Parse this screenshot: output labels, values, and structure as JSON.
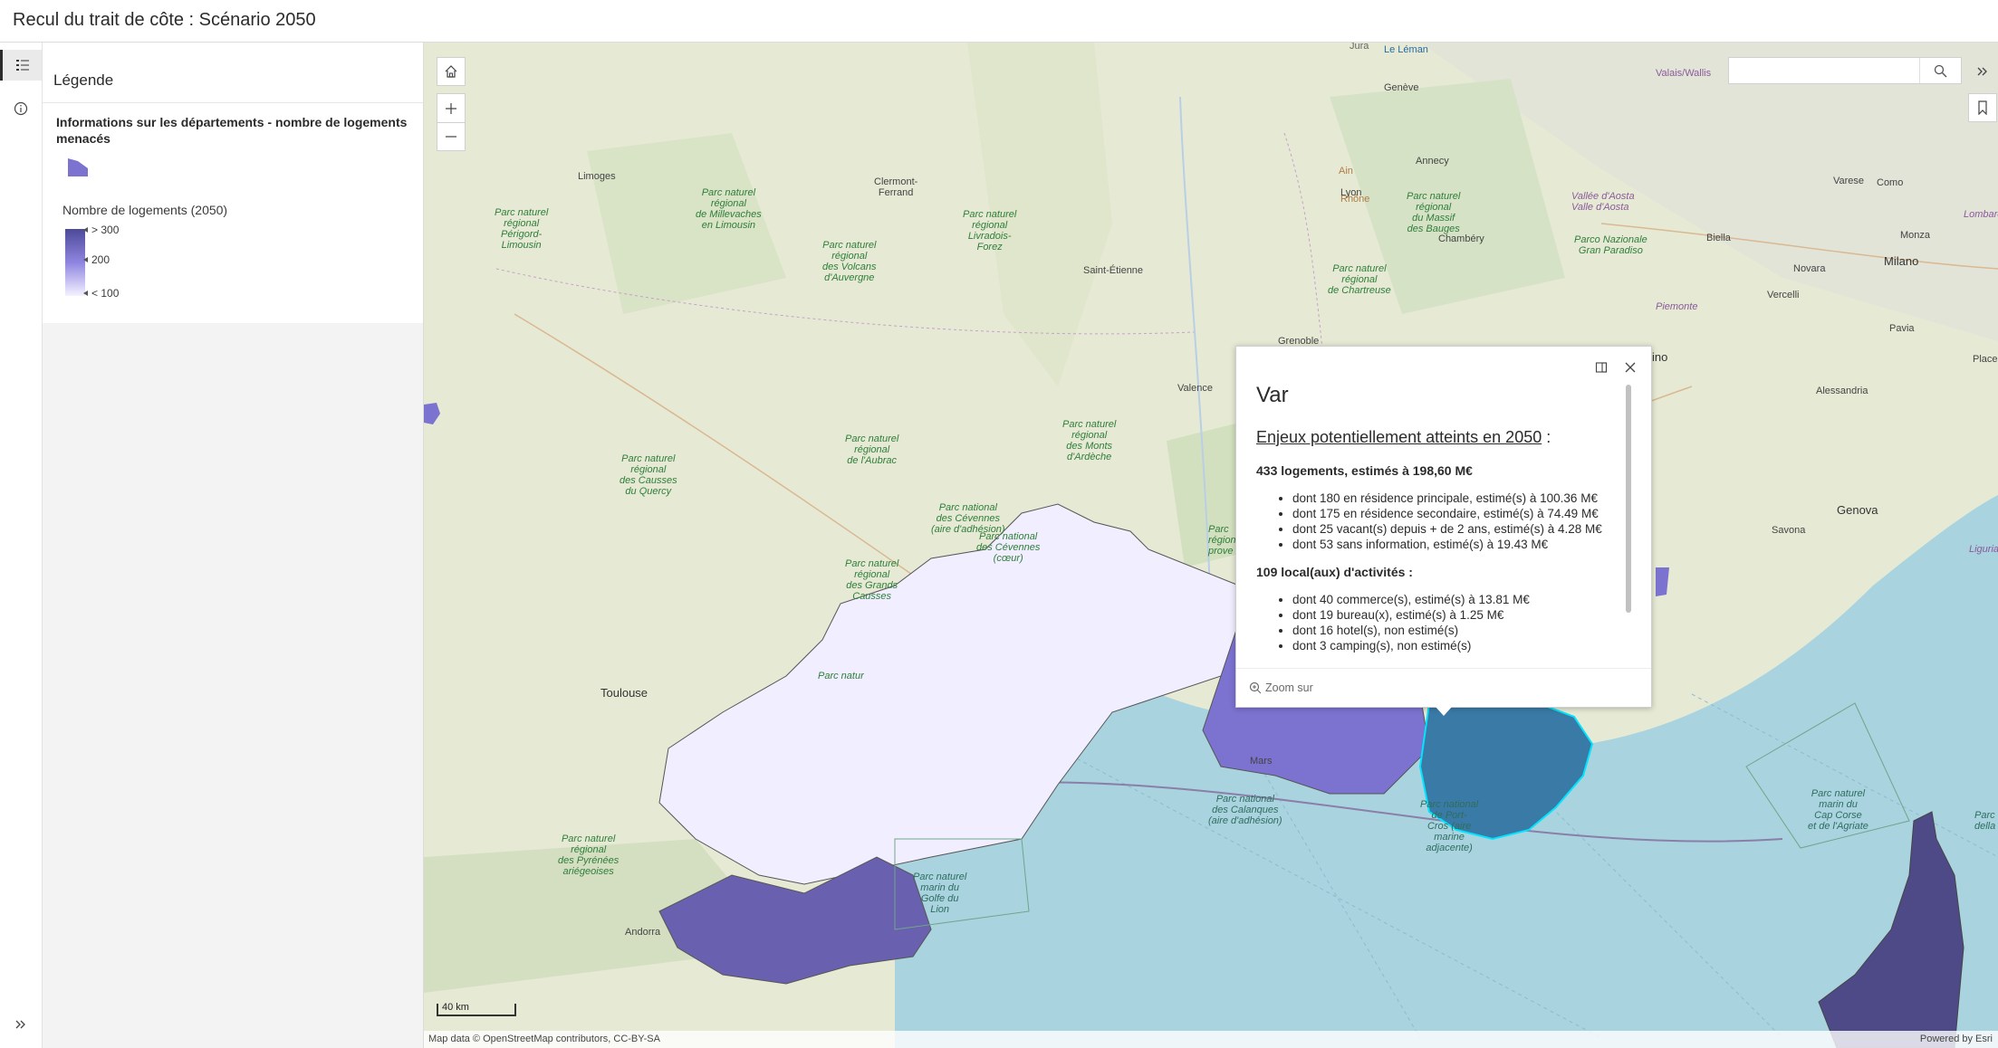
{
  "app": {
    "title": "Recul du trait de côte : Scénario 2050"
  },
  "rail": {
    "legend_icon": "legend-icon",
    "info_icon": "info-icon",
    "expand_icon": "chevrons-right-icon"
  },
  "legend": {
    "heading": "Légende",
    "layer_title": "Informations sur les départements - nombre de logements menacés",
    "ramp_title": "Nombre de logements (2050)",
    "ramp_labels": {
      "high": "> 300",
      "mid": "200",
      "low": "< 100"
    },
    "ramp_colors": {
      "high": "#4d4a99",
      "mid": "#8f85e0",
      "low": "#f4f2ff"
    }
  },
  "map": {
    "search": {
      "placeholder": "",
      "value": ""
    },
    "scale": "40 km",
    "attribution_left": "Map data © OpenStreetMap contributors, CC-BY-SA",
    "attribution_right": "Powered by Esri",
    "cities": {
      "geneve": "Genève",
      "annecy": "Annecy",
      "chambery": "Chambéry",
      "lyon": "Lyon",
      "clermont": "Clermont-\nFerrand",
      "limoges": "Limoges",
      "saint_etienne": "Saint-Étienne",
      "grenoble": "Grenoble",
      "valence": "Valence",
      "toulouse": "Toulouse",
      "andorra": "Andorra",
      "milano": "Milano",
      "novara": "Novara",
      "biella": "Biella",
      "vercelli": "Vercelli",
      "monza": "Monza",
      "varese": "Varese",
      "como": "Como",
      "pavia": "Pavia",
      "alessandria": "Alessandria",
      "genova": "Genova",
      "savona": "Savona",
      "marseille": "Mars",
      "piemonte": "Piemonte",
      "vallee_aoste": "Vallée d'Aosta\nValle d'Aosta",
      "valais": "Valais/Wallis",
      "lombardia": "Lombard",
      "torino": "ino",
      "placen": "Placen",
      "liguria": "Liguria",
      "jura": "Jura",
      "leman": "Le Léman",
      "rhone": "Rhône",
      "ain": "Ain"
    },
    "parks": {
      "millevaches": "Parc naturel\nrégional\nde Millevaches\nen Limousin",
      "perigord": "Parc naturel\nrégional\nPérigord-\nLimousin",
      "volcans": "Parc naturel\nrégional\ndes Volcans\nd'Auvergne",
      "livradois": "Parc naturel\nrégional\nLivradois-\nForez",
      "massif_bauges": "Parc naturel\nrégional\ndu Massif\ndes Bauges",
      "chartreuse": "Parc naturel\nrégional\nde Chartreuse",
      "grand_paradiso": "Parco Nazionale\nGran Paradiso",
      "monts_ardeche": "Parc naturel\nrégional\ndes Monts\nd'Ardèche",
      "aubrac": "Parc naturel\nrégional\nde l'Aubrac",
      "causses_quercy": "Parc naturel\nrégional\ndes Causses\ndu Quercy",
      "cevennes_adh": "Parc national\ndes Cévennes\n(aire d'adhésion)",
      "cevennes_coeur": "Parc national\ndes Cévennes\n(cœur)",
      "grands_causses": "Parc naturel\nrégional\ndes Grands\nCausses",
      "pyrenees": "Parc naturel\nrégional\ndes Pyrénées\nariégeoises",
      "natur": "Parc natur",
      "provence": "Parc\nrégional\nprove"
    },
    "sea_parks": {
      "golfe_lion": "Parc naturel\nmarin du\nGolfe du\nLion",
      "calanques": "Parc national\ndes Calanques\n(aire d'adhésion)",
      "port_cros": "Parc national\nde Port-\nCros (aire\nmarine\nadjacente)",
      "cap_corse": "Parc naturel\nmarin du\nCap Corse\net de l'Agriate",
      "della": "Parc\ndella"
    },
    "colors": {
      "sea": "#a9d3df",
      "land": "#e8ecd9",
      "herault": "#f1efff",
      "bouches_du_rhone": "#7c72d0",
      "pyrenees_orientales": "#6a60b0",
      "var_selected": "#3a7aa6",
      "corse": "#4e4a88",
      "selection_outline": "#00e5ff"
    }
  },
  "popup": {
    "title": "Var",
    "subtitle": "Enjeux potentiellement atteints en 2050",
    "subtitle_suffix": " :",
    "housing_summary": "433  logements, estimés à 198,60 M€",
    "housing_items": [
      "dont 180 en résidence principale, estimé(s) à 100.36 M€",
      "dont 175 en résidence secondaire, estimé(s) à 74.49 M€",
      "dont 25 vacant(s) depuis + de 2 ans, estimé(s) à 4.28 M€",
      "dont 53 sans information, estimé(s) à 19.43 M€"
    ],
    "activity_summary": "109 local(aux) d'activités :",
    "activity_items": [
      "dont 40 commerce(s), estimé(s) à 13.81 M€",
      "dont 19 bureau(x), estimé(s) à 1.25 M€",
      "dont 16 hotel(s), non estimé(s)",
      "dont 3 camping(s), non estimé(s)"
    ],
    "zoom_label": "Zoom sur"
  }
}
